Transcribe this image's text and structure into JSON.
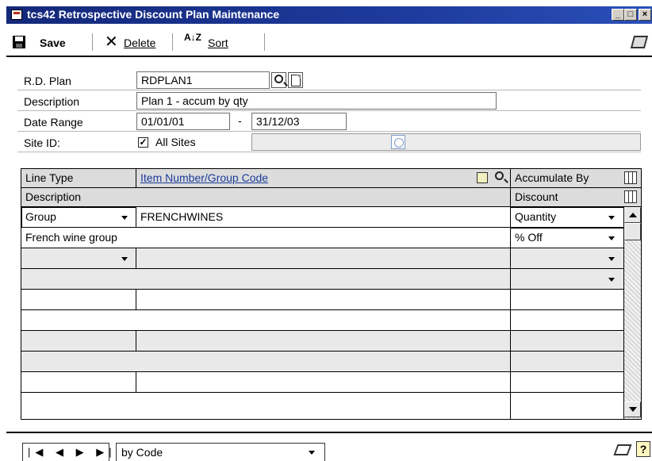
{
  "window": {
    "title": "tcs42 Retrospective Discount Plan Maintenance",
    "min_label": "_",
    "max_label": "□",
    "close_label": "×"
  },
  "toolbar": {
    "save_label": "Save",
    "delete_label": "Delete",
    "sort_label": "Sort",
    "sort_glyph": "A↓Z"
  },
  "form": {
    "rd_plan_label": "R.D. Plan",
    "rd_plan_value": "RDPLAN1",
    "description_label": "Description",
    "description_value": "Plan 1 - accum by qty",
    "date_range_label": "Date Range",
    "date_from": "01/01/01",
    "date_sep": "-",
    "date_to": "31/12/03",
    "site_id_label": "Site ID:",
    "all_sites_label": "All Sites",
    "all_sites_checked": true,
    "check_glyph": "✓"
  },
  "grid": {
    "headers": {
      "line_type": "Line Type",
      "item_number": "Item Number/Group Code",
      "accumulate_by": "Accumulate By",
      "description": "Description",
      "discount": "Discount"
    },
    "rows": [
      {
        "line_type": "Group",
        "item_code": "FRENCHWINES",
        "accumulate_by": "Quantity",
        "description": "French wine group",
        "discount": "% Off"
      }
    ]
  },
  "bottom": {
    "nav_glyphs": "|◀ ◀ ▶ ▶|",
    "sort_by": "by Code",
    "help_glyph": "?"
  }
}
